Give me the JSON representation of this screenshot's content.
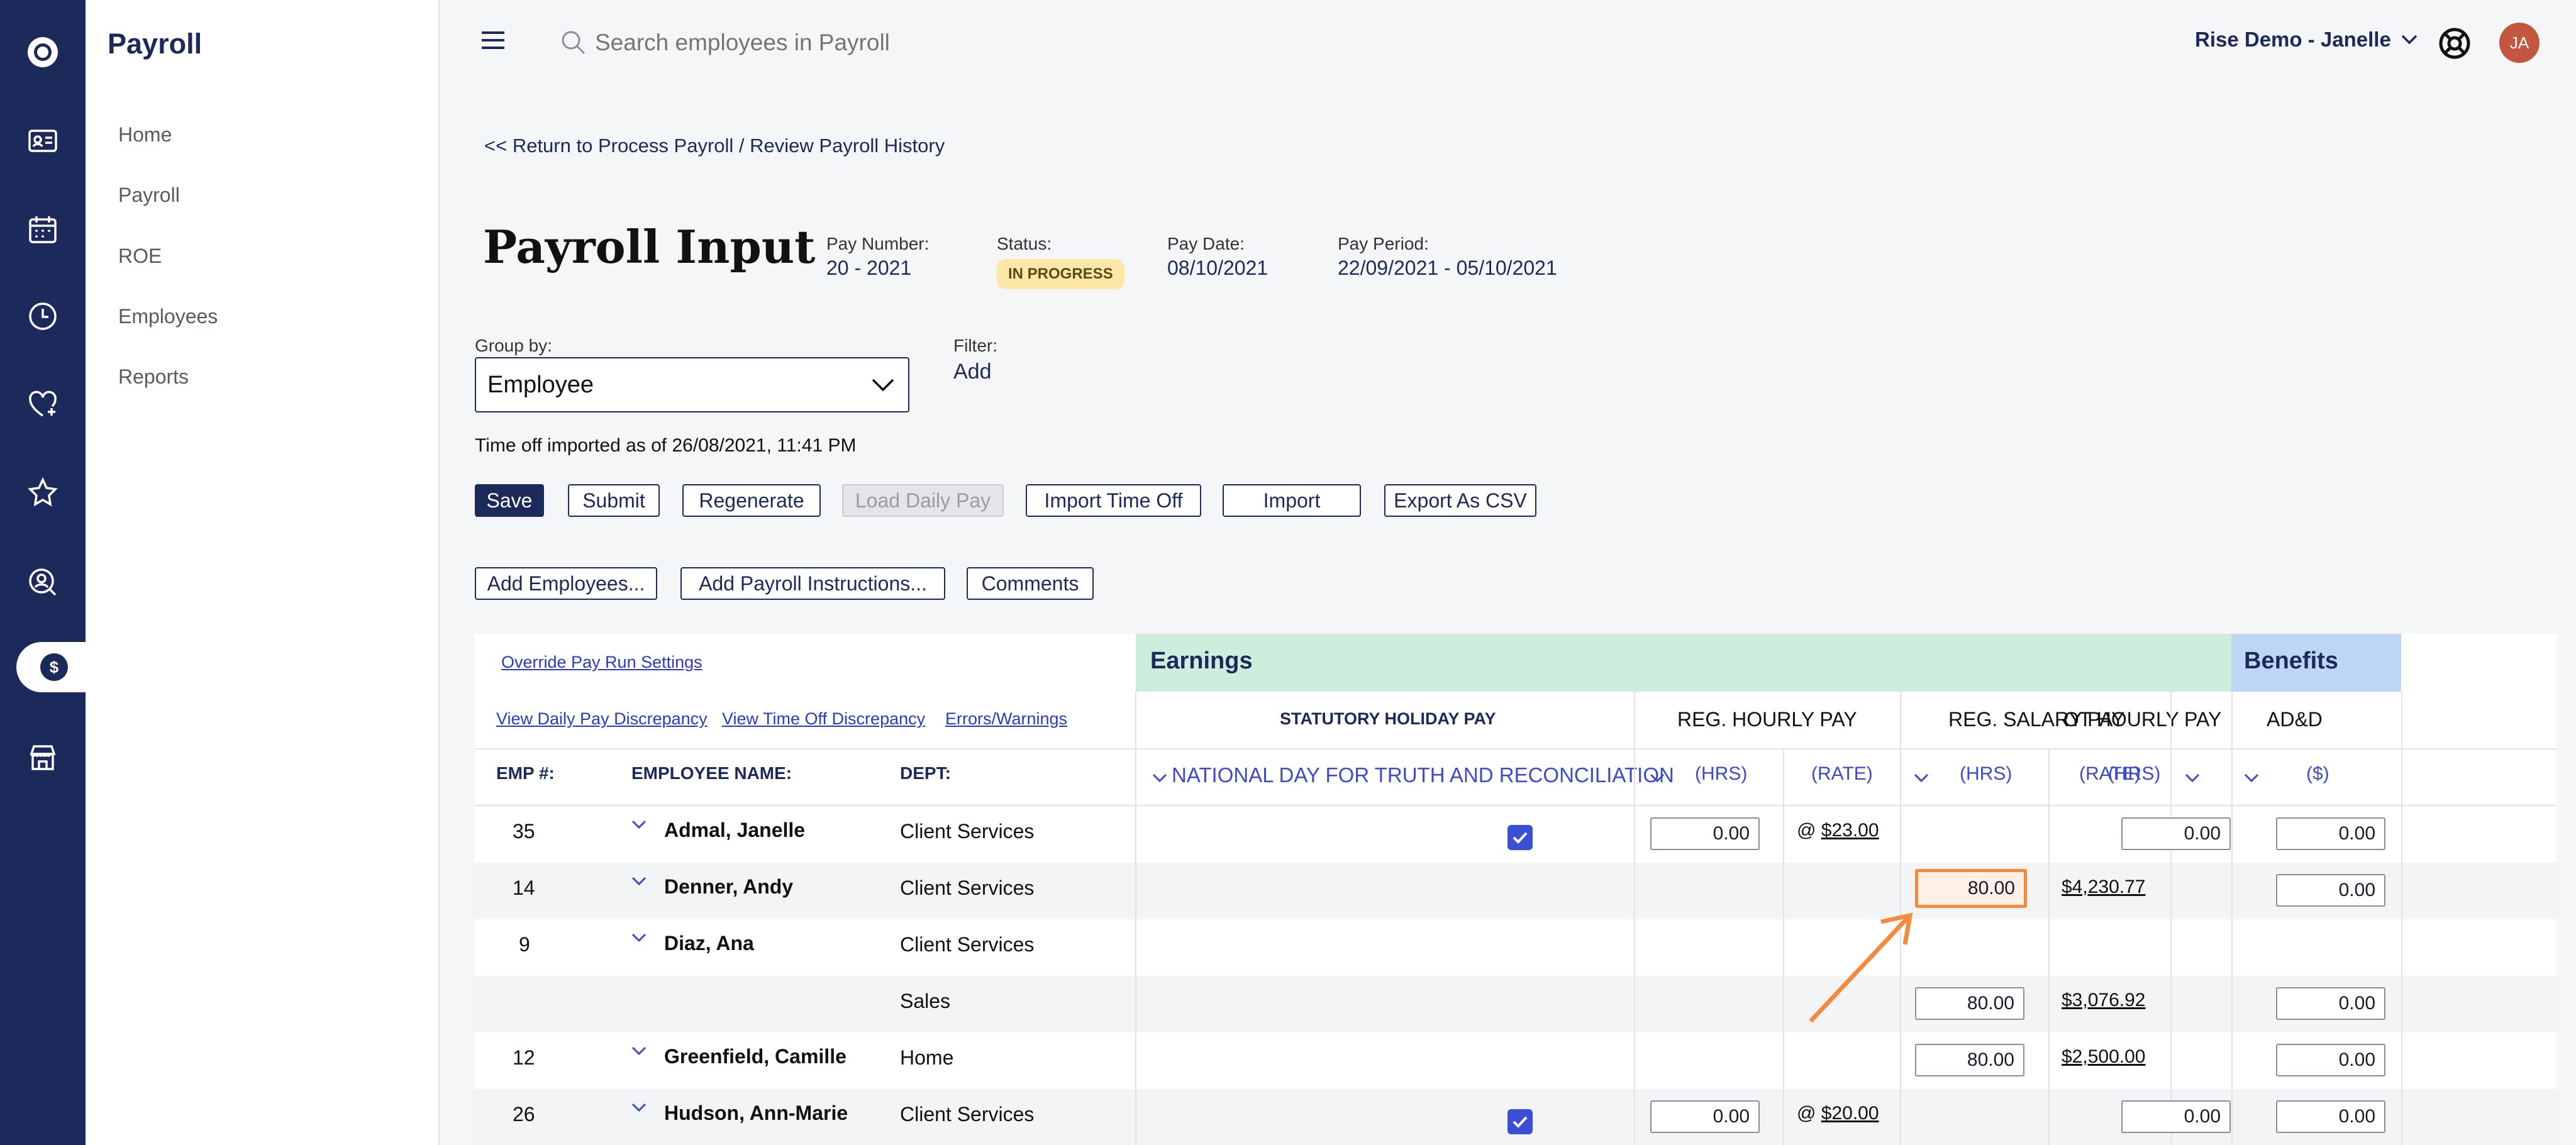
{
  "app": {
    "title": "Payroll"
  },
  "nav": {
    "items": [
      "Home",
      "Payroll",
      "ROE",
      "Employees",
      "Reports"
    ]
  },
  "search": {
    "placeholder": "Search employees in Payroll"
  },
  "account": {
    "name": "Rise Demo - Janelle",
    "avatar_initials": "JA"
  },
  "back_link": "<< Return to Process Payroll / Review Payroll History",
  "page": {
    "title": "Payroll Input",
    "pay_number_label": "Pay Number:",
    "pay_number": "20 - 2021",
    "status_label": "Status:",
    "status": "IN PROGRESS",
    "pay_date_label": "Pay Date:",
    "pay_date": "08/10/2021",
    "pay_period_label": "Pay Period:",
    "pay_period": "22/09/2021 - 05/10/2021"
  },
  "group_by": {
    "label": "Group by:",
    "value": "Employee"
  },
  "filter": {
    "label": "Filter:",
    "action": "Add"
  },
  "timeoff_note": "Time off imported as of 26/08/2021, 11:41 PM",
  "toolbar": {
    "save": "Save",
    "submit": "Submit",
    "regenerate": "Regenerate",
    "load_daily_pay": "Load Daily Pay",
    "import_time_off": "Import Time Off",
    "import": "Import",
    "export_csv": "Export As CSV"
  },
  "toolbar2": {
    "add_employees": "Add Employees...",
    "add_payroll_instructions": "Add Payroll Instructions...",
    "comments": "Comments"
  },
  "grid": {
    "override_link": "Override Pay Run Settings",
    "daily_discrepancy": "View Daily Pay Discrepancy",
    "timeoff_discrepancy": "View Time Off Discrepancy",
    "errors_warnings": "Errors/Warnings",
    "col_emp": "EMP #:",
    "col_name": "EMPLOYEE NAME:",
    "col_dept": "DEPT:",
    "earnings": "Earnings",
    "benefits": "Benefits",
    "stat_holiday": "STATUTORY HOLIDAY PAY",
    "stat_holiday_sub": "NATIONAL DAY FOR TRUTH AND RECONCILIATION",
    "reg_hourly": "REG. HOURLY PAY",
    "reg_salary": "REG. SALARY PAY",
    "ot_hourly": "OT HOURLY PAY",
    "add": "AD&D",
    "hrs": "(HRS)",
    "rate": "(RATE)",
    "dollars": "($)",
    "rows": [
      {
        "emp": "35",
        "name": "Admal, Janelle",
        "dept": "Client Services",
        "stat": true,
        "reg_hrs": "0.00",
        "reg_rate": "$23.00",
        "ot_hrs": "0.00",
        "add": "0.00"
      },
      {
        "emp": "14",
        "name": "Denner, Andy",
        "dept": "Client Services",
        "sal_hrs": "80.00",
        "sal_rate": "$4,230.77",
        "add": "0.00"
      },
      {
        "emp": "9",
        "name": "Diaz, Ana",
        "dept": "Client Services"
      },
      {
        "emp": "",
        "name": "",
        "dept": "Sales",
        "sal_hrs": "80.00",
        "sal_rate": "$3,076.92",
        "add": "0.00"
      },
      {
        "emp": "12",
        "name": "Greenfield, Camille",
        "dept": "Home",
        "sal_hrs": "80.00",
        "sal_rate": "$2,500.00",
        "add": "0.00"
      },
      {
        "emp": "26",
        "name": "Hudson, Ann-Marie",
        "dept": "Client Services",
        "stat": true,
        "reg_hrs": "0.00",
        "reg_rate": "$20.00",
        "ot_hrs": "0.00",
        "add": "0.00"
      }
    ]
  },
  "colors": {
    "rail": "#1b2a5b",
    "earnings_bg": "#cdeedd",
    "benefits_bg": "#bcd6f3",
    "highlight": "#f58a3c"
  }
}
